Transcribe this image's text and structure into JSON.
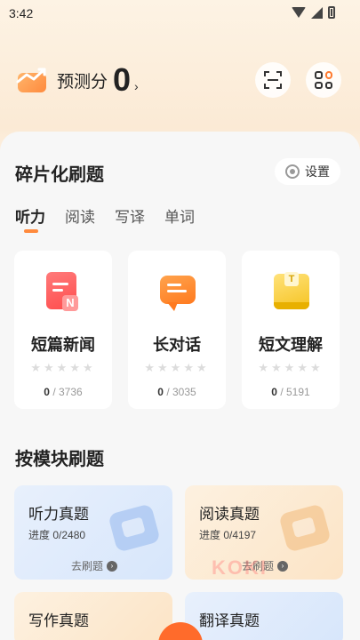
{
  "status_bar": {
    "time": "3:42"
  },
  "header": {
    "score_label": "预测分",
    "score_value": "0",
    "chevron": "›",
    "scan_icon": "scan-icon",
    "grid_icon": "grid-icon"
  },
  "fragment": {
    "title": "碎片化刷题",
    "settings_label": "设置",
    "tabs": [
      {
        "label": "听力",
        "active": true
      },
      {
        "label": "阅读",
        "active": false
      },
      {
        "label": "写译",
        "active": false
      },
      {
        "label": "单词",
        "active": false
      }
    ],
    "cards": [
      {
        "name": "短篇新闻",
        "icon": "news-doc-icon",
        "badge": "N",
        "stars": "★★★★★",
        "done": "0",
        "total": " / 3736"
      },
      {
        "name": "长对话",
        "icon": "chat-bubble-icon",
        "stars": "★★★★★",
        "done": "0",
        "total": " / 3035"
      },
      {
        "name": "短文理解",
        "icon": "book-icon",
        "badge": "T",
        "stars": "★★★★★",
        "done": "0",
        "total": " / 5191"
      }
    ]
  },
  "modules": {
    "title": "按模块刷题",
    "items": [
      {
        "title": "听力真题",
        "progress": "进度 0/2480",
        "go": "去刷题"
      },
      {
        "title": "阅读真题",
        "progress": "进度 0/4197",
        "go": "去刷题"
      },
      {
        "title": "写作真题"
      },
      {
        "title": "翻译真题"
      }
    ]
  },
  "watermark": "KOKI",
  "colors": {
    "accent": "#ff8a3d",
    "tab_indicator": "#ff8a3d"
  }
}
